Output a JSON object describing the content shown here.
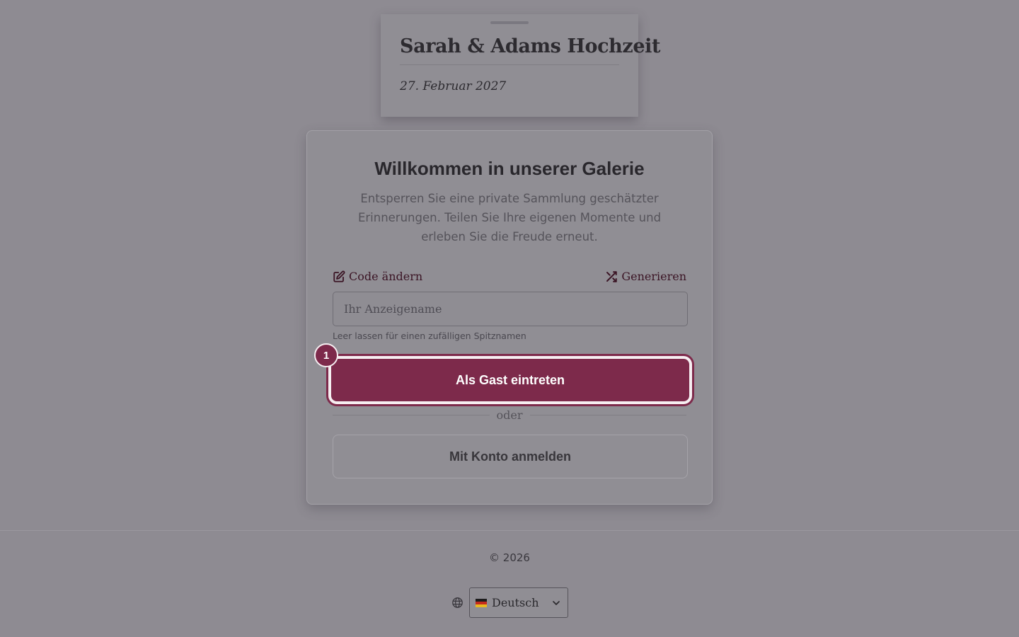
{
  "header": {
    "title": "Sarah & Adams Hochzeit",
    "date": "27. Februar 2027"
  },
  "panel": {
    "heading": "Willkommen in unserer Galerie",
    "lead": "Entsperren Sie eine private Sammlung geschätzter Erinnerungen. Teilen Sie Ihre eigenen Momente und erleben Sie die Freude erneut.",
    "change_code_label": "Code ändern",
    "generate_label": "Generieren",
    "name_placeholder": "Ihr Anzeigename",
    "name_value": "",
    "hint": "Leer lassen für einen zufälligen Spitznamen",
    "step_badge": "1",
    "guest_button_label": "Als Gast eintreten",
    "divider_text": "oder",
    "account_button_label": "Mit Konto anmelden"
  },
  "footer": {
    "copyright": "© 2026",
    "language": {
      "selected": "Deutsch",
      "flag": "de"
    }
  },
  "colors": {
    "accent": "#7d2a4b",
    "overlay_bg": "#8e8b92"
  },
  "icons": {
    "change_code": "edit-icon",
    "generate": "shuffle-icon",
    "language": "globe-icon",
    "dropdown": "chevron-down-icon"
  }
}
